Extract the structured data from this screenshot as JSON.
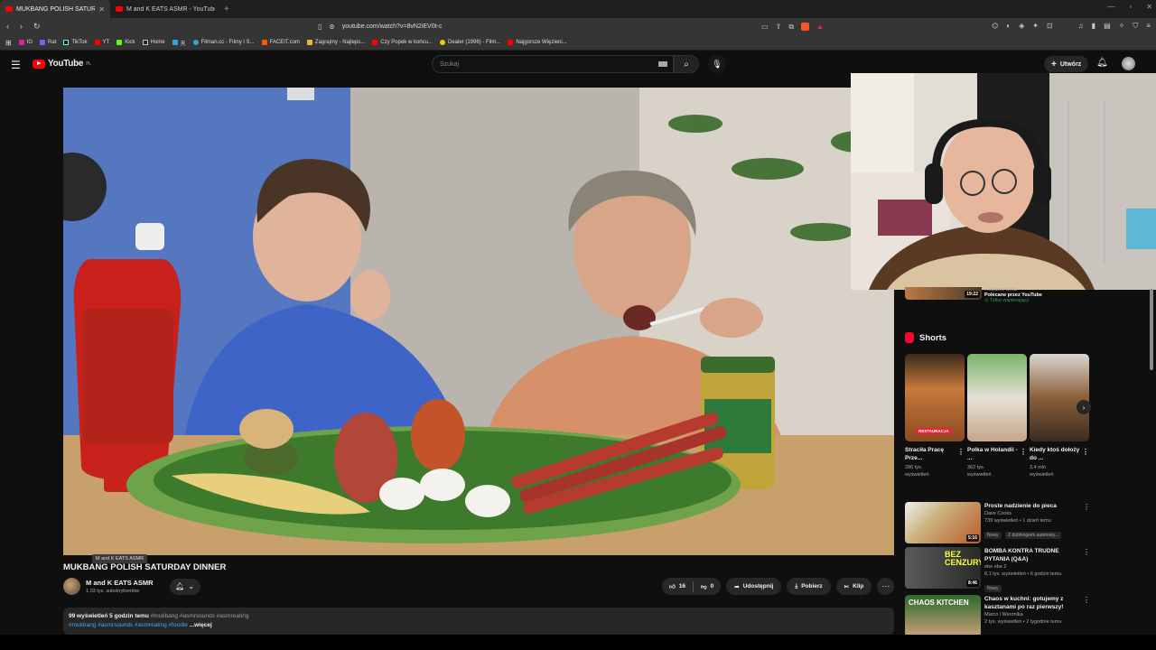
{
  "browser": {
    "tabs": [
      {
        "title": "MUKBANG POLISH SATURDAY DINNER",
        "active": true
      },
      {
        "title": "M and K EATS ASMR - YouTube",
        "active": false
      }
    ],
    "url": "youtube.com/watch?v=8vN2iEV0t-c",
    "bookmarks": [
      {
        "label": "IG",
        "color": "#d6249f"
      },
      {
        "label": "Rat",
        "color": "#7b5cff"
      },
      {
        "label": "TikTok",
        "color": "#111111"
      },
      {
        "label": "YT",
        "color": "#ff0000"
      },
      {
        "label": "Kick",
        "color": "#53fc18"
      },
      {
        "label": "Home",
        "color": "#222222"
      },
      {
        "label": "天",
        "color": "#2aa7e0"
      },
      {
        "label": "Filman.cc - Filmy i S...",
        "color": "#3aa0d0"
      },
      {
        "label": "FACEIT.com",
        "color": "#ff5500"
      },
      {
        "label": "Zagrajmy - Najleps...",
        "color": "#e8b339"
      },
      {
        "label": "Czy Popek w końcu...",
        "color": "#ff0000"
      },
      {
        "label": "Dealer (1996) - Film...",
        "color": "#f5c518"
      },
      {
        "label": "Najgorsze Więzieni...",
        "color": "#ff0000"
      }
    ]
  },
  "youtube": {
    "logo": "YouTube",
    "region": "PL",
    "search_placeholder": "Szukaj",
    "create_label": "Utwórz"
  },
  "video": {
    "title": "MUKBANG POLISH SATURDAY DINNER",
    "tooltip": "M and K EATS ASMR",
    "channel": "M and K EATS ASMR",
    "subscribers": "1,03 tys. subskrybentów",
    "likes": "16",
    "dislikes": "0",
    "share": "Udostępnij",
    "download": "Pobierz",
    "clip": "Klip",
    "views": "99 wyświetleń",
    "age": "5 godzin temu",
    "tags_line1": "#mukbang #asmrsounds #asmreating",
    "tags_line2": "#mukbang #asmrsounds #asmreating #foodie",
    "more": "...więcej"
  },
  "sidebar": {
    "rec_top": {
      "meta": "...Iskome temu",
      "title": "Polecane przez YouTube",
      "badge": "Tylko wspierający",
      "duration": "19:22"
    },
    "shorts_heading": "Shorts",
    "shorts": [
      {
        "title": "Straciła Pracę Prze...",
        "views": "286 tys.",
        "views_label": "wyświetleń",
        "tag": "RESTAURACJA"
      },
      {
        "title": "Polka w Holandii - ...",
        "views": "362 tys.",
        "views_label": "wyświetleń",
        "tag": ""
      },
      {
        "title": "Kiedy ktoś dołoży do ...",
        "views": "3,4 mln",
        "views_label": "wyświetleń",
        "tag": ""
      }
    ],
    "recommendations": [
      {
        "title": "Proste nadzienie do pieca",
        "channel": "Dave Cooks",
        "meta": "739 wyświetleń • 1 dzień temu",
        "badge": "Nowy",
        "extra": "Z dubbingiem automaty...",
        "duration": "5:16"
      },
      {
        "title": "BOMBA KONTRA TRUDNE PYTANIA (Q&A)",
        "channel": "ebe ebe 2",
        "meta": "8,1 tys. wyświetleń • 6 godzin temu",
        "badge": "Nowy",
        "extra": "",
        "duration": "8:46"
      },
      {
        "title": "Chaos w kuchni: gotujemy z kasztanami po raz pierwszy!",
        "channel": "Marco i Weronika",
        "meta": "2 tys. wyświetleń • 2 tygodnie temu",
        "badge": "",
        "extra": "",
        "duration": ""
      }
    ],
    "thumb_text_2": "BEZ CENZURY",
    "thumb_text_3": "CHAOS KITCHEN"
  }
}
